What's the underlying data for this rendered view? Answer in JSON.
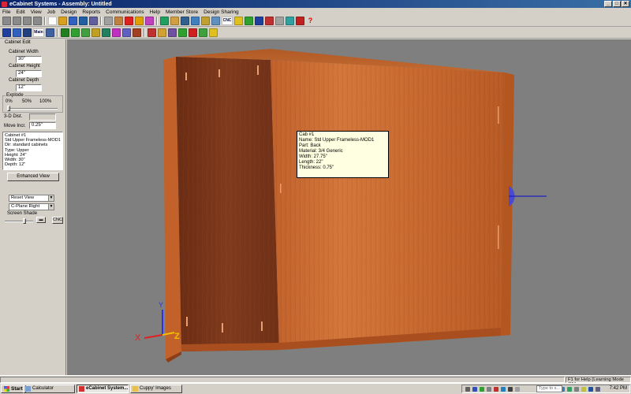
{
  "window": {
    "title": "eCabinet Systems - Assembly: Untitled",
    "controls": [
      "_",
      "□",
      "✕"
    ]
  },
  "menu": [
    "File",
    "Edit",
    "View",
    "Job",
    "Design",
    "Reports",
    "Communications",
    "Help",
    "Member Store",
    "Design Sharing"
  ],
  "toolbar1": {
    "text_buttons": {
      "cnc": "CNC"
    },
    "help_glyph": "?",
    "colors": [
      "#8a8a8a",
      "#8a8a8a",
      "#8a8a8a",
      "#8a8a8a",
      "#ffffff",
      "#d8a020",
      "#3060c0",
      "#2060a0",
      "#6060a0",
      "#a0a0a0",
      "#c08040",
      "#e02020",
      "#e0a000",
      "#c040c0",
      "#20a060",
      "#d0a040",
      "#306090",
      "#4080c0",
      "#c0a030",
      "#6090c0",
      "#e0c020",
      "#30a030",
      "#2040a0",
      "#c03030",
      "#a0a0a0",
      "#30a0a0",
      "#c02020"
    ]
  },
  "toolbar2": {
    "text_buttons": {
      "main": "Main"
    },
    "colors": [
      "#2040a0",
      "#3060c0",
      "#204080",
      "#4060a0",
      "#208020",
      "#30a030",
      "#40a040",
      "#c0a020",
      "#208060",
      "#c030c0",
      "#6060c0",
      "#a04020",
      "#c03030",
      "#d0a030",
      "#7050a0",
      "#30a030",
      "#d02020",
      "#40a040",
      "#e0c020"
    ]
  },
  "panel": {
    "heading": "Cabinet Edit",
    "width_label": "Cabinet Width",
    "width_value": "30\"",
    "height_label": "Cabinet Height",
    "height_value": "24\"",
    "depth_label": "Cabinet Depth",
    "depth_value": "12\"",
    "explode_label": "Explode",
    "explode_ticks": [
      "0%",
      "50%",
      "100%"
    ],
    "explode_level": 0,
    "dist_label": "3-D Dist.",
    "move_label": "Move Incr.",
    "move_value": "0.25\"",
    "info_lines": [
      "Cabinet #1",
      "Std Upper Frameless-MOD1",
      "Dir: standard cabinets",
      "Type: Upper",
      "Height: 24\"",
      "Width: 30\"",
      "Depth: 12\""
    ],
    "enhanced_view_button": "Enhanced View",
    "reset_view": "Reset View",
    "plane_view": "C-Plane Right",
    "screen_shade_label": "Screen Shade",
    "cnc_button": "CNC"
  },
  "tooltip": {
    "lines": [
      "Cab #1",
      "Name: Std Upper Frameless-MOD1",
      "Part: Back",
      "Material: 3/4 Generic",
      "Width: 27.75\"",
      "Length: 22\"",
      "Thickness: 0.75\""
    ]
  },
  "axes": {
    "x": "X",
    "y": "Y",
    "z": "Z",
    "x_color": "#e02020",
    "y_color": "#3030e0",
    "z_color": "#f0c000"
  },
  "colors": {
    "viewport_bg": "#7f7f7f",
    "wood_light": "#c8682a",
    "wood_dark": "#7a3418",
    "tooltip_bg": "#ffffe1"
  },
  "statusbar": {
    "help_text": "F1 for Help (Learning Mode ON)"
  },
  "taskbar": {
    "start": "Start",
    "buttons": [
      "Calculator",
      "eCabinet System...",
      "Cuppy' Images"
    ],
    "search_placeholder": "Type to s...",
    "clock": "7:42 PM"
  }
}
